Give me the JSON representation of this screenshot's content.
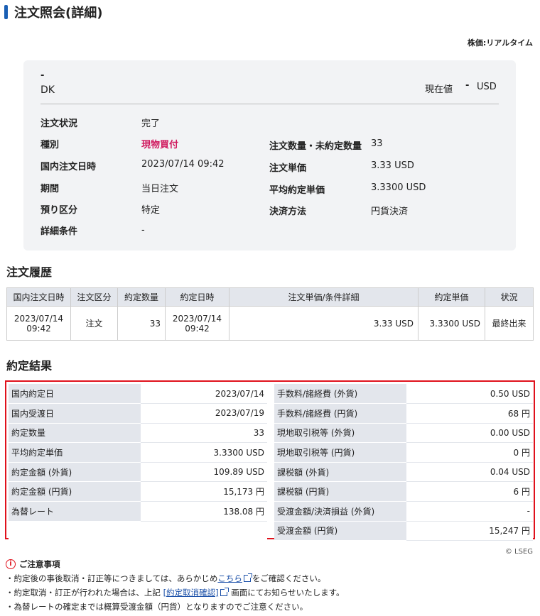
{
  "page": {
    "title": "注文照会(詳細)",
    "price_mode": "株価:リアルタイム"
  },
  "summary": {
    "symbol_dash": "-",
    "symbol_code": "DK",
    "current_price_label": "現在値",
    "current_price_value": "-",
    "current_price_unit": "USD",
    "rows_left": [
      {
        "label": "注文状況",
        "value": "完了"
      },
      {
        "label": "種別",
        "value": "現物買付"
      },
      {
        "label": "国内注文日時",
        "value": "2023/07/14 09:42"
      },
      {
        "label": "期間",
        "value": "当日注文"
      },
      {
        "label": "預り区分",
        "value": "特定"
      },
      {
        "label": "詳細条件",
        "value": "-"
      }
    ],
    "rows_right": [
      {
        "label": "注文数量・未約定数量",
        "value": "33"
      },
      {
        "label": "注文単価",
        "value": "3.33 USD"
      },
      {
        "label": "平均約定単価",
        "value": "3.3300 USD"
      },
      {
        "label": "決済方法",
        "value": "円貨決済"
      }
    ]
  },
  "history": {
    "title": "注文履歴",
    "columns": [
      "国内注文日時",
      "注文区分",
      "約定数量",
      "約定日時",
      "注文単価/条件詳細",
      "約定単価",
      "状況"
    ],
    "rows": [
      {
        "order_date": "2023/07/14",
        "order_time": "09:42",
        "type": "注文",
        "qty": "33",
        "exec_date": "2023/07/14",
        "exec_time": "09:42",
        "order_price": "3.33 USD",
        "exec_price": "3.3300 USD",
        "status": "最終出来"
      }
    ]
  },
  "result": {
    "title": "約定結果",
    "left": [
      {
        "label": "国内約定日",
        "value": "2023/07/14"
      },
      {
        "label": "国内受渡日",
        "value": "2023/07/19"
      },
      {
        "label": "約定数量",
        "value": "33"
      },
      {
        "label": "平均約定単価",
        "value": "3.3300 USD"
      },
      {
        "label": "約定金額 (外貨)",
        "value": "109.89 USD"
      },
      {
        "label": "約定金額 (円貨)",
        "value": "15,173 円"
      },
      {
        "label": "為替レート",
        "value": "138.08 円"
      }
    ],
    "right": [
      {
        "label": "手数料/諸経費 (外貨)",
        "value": "0.50 USD"
      },
      {
        "label": "手数料/諸経費 (円貨)",
        "value": "68 円"
      },
      {
        "label": "現地取引税等 (外貨)",
        "value": "0.00 USD"
      },
      {
        "label": "現地取引税等 (円貨)",
        "value": "0 円"
      },
      {
        "label": "課税額 (外貨)",
        "value": "0.04 USD"
      },
      {
        "label": "課税額 (円貨)",
        "value": "6 円"
      },
      {
        "label": "受渡金額/決済損益 (外貨)",
        "value": "-"
      },
      {
        "label": "受渡金額 (円貨)",
        "value": "15,247 円"
      }
    ]
  },
  "footer": {
    "source": "© LSEG",
    "notes_title": "ご注意事項",
    "note1_before": "・約定後の事後取消・訂正等につきましては、あらかじめ",
    "note1_link": "こちら",
    "note1_after": "をご確認ください。",
    "note2_before": "・約定取消・訂正が行われた場合は、上記",
    "note2_link": "[約定取消確認]",
    "note2_after": "画面にてお知らせいたします。",
    "note3": "・為替レートの確定までは概算受渡金額（円貨）となりますのでご注意ください。"
  }
}
